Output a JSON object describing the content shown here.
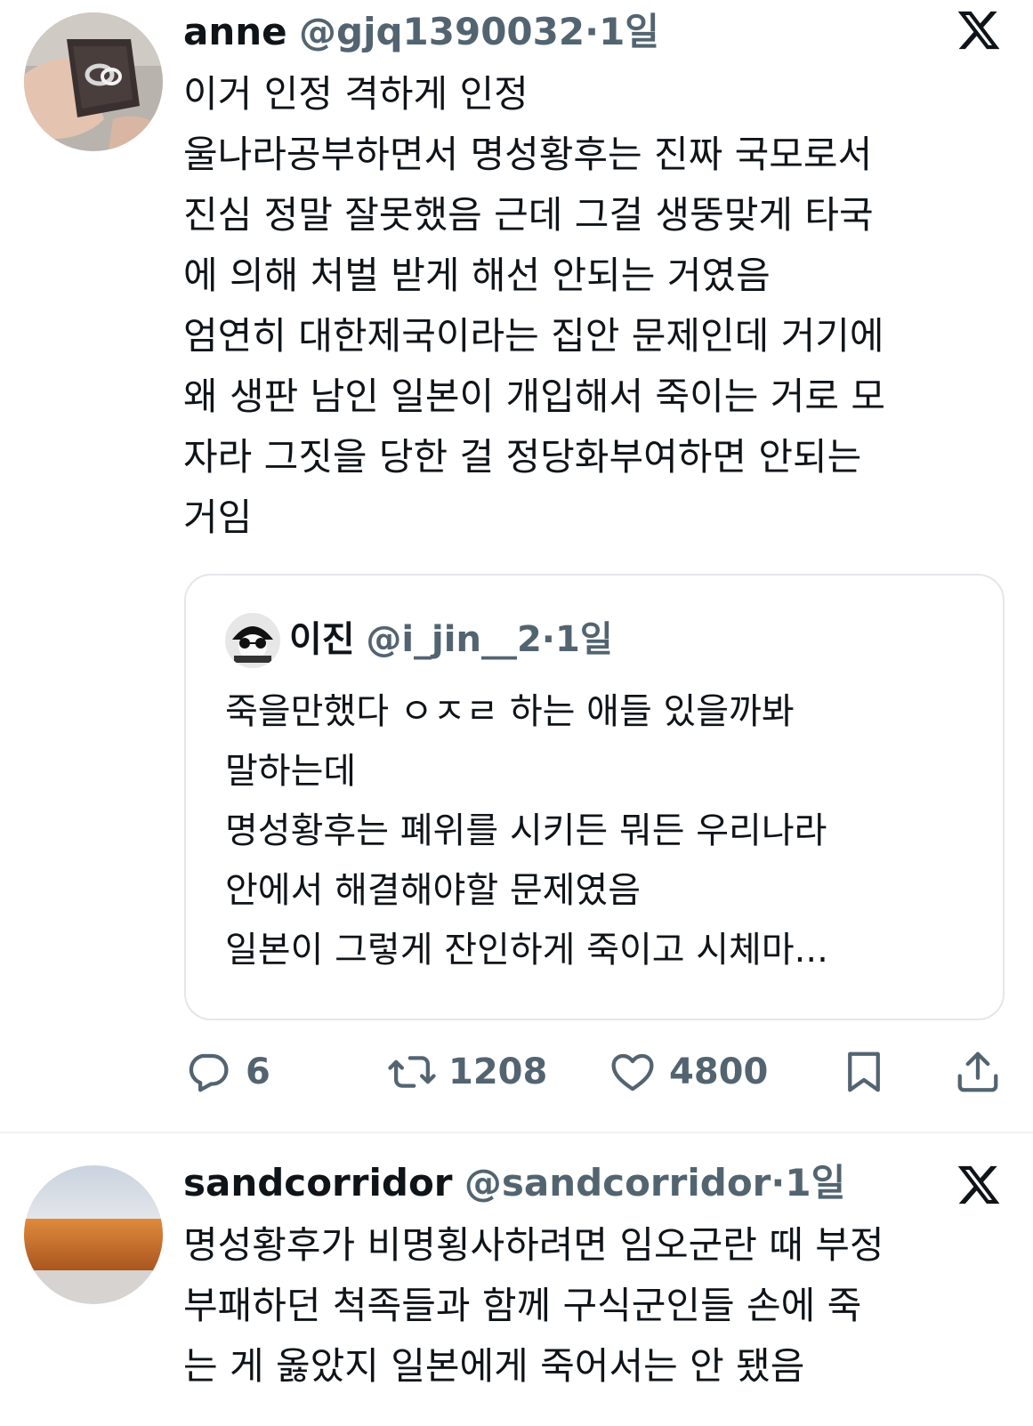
{
  "tweets": [
    {
      "display_name": "anne",
      "handle": "@gjq1390032",
      "separator": "·",
      "time": "1일",
      "text": "이거 인정 격하게 인정\n울나라공부하면서 명성황후는 진짜 국모로서\n진심 정말 잘못했음 근데 그걸 생뚱맞게 타국\n에 의해 처벌 받게 해선 안되는 거였음\n엄연히 대한제국이라는 집안 문제인데 거기에\n왜 생판 남인 일본이 개입해서 죽이는 거로 모\n자라 그짓을 당한 걸 정당화부여하면 안되는\n거임",
      "quote": {
        "display_name": "이진",
        "handle": "@i_jin__2",
        "separator": "·",
        "time": "1일",
        "text": "죽을만했다 ㅇㅈㄹ 하는 애들 있을까봐\n말하는데\n명성황후는 폐위를 시키든 뭐든 우리나라\n안에서 해결해야할 문제였음\n일본이 그렇게 잔인하게 죽이고 시체마..."
      },
      "stats": {
        "replies": "6",
        "retweets": "1208",
        "likes": "4800"
      }
    },
    {
      "display_name": "sandcorridor",
      "handle": "@sandcorridor",
      "separator": "·",
      "time": "1일",
      "text": "명성황후가 비명횡사하려면 임오군란 때 부정\n부패하던 척족들과 함께 구식군인들 손에 죽\n는 게 옳았지 일본에게 죽어서는 안 됐음"
    }
  ],
  "icons": {
    "x_logo": "x-logo-icon",
    "reply": "reply-icon",
    "retweet": "retweet-icon",
    "like": "heart-icon",
    "bookmark": "bookmark-icon",
    "share": "share-icon"
  },
  "colors": {
    "text": "#0f1419",
    "muted": "#536471",
    "border": "#e3e7ea"
  }
}
